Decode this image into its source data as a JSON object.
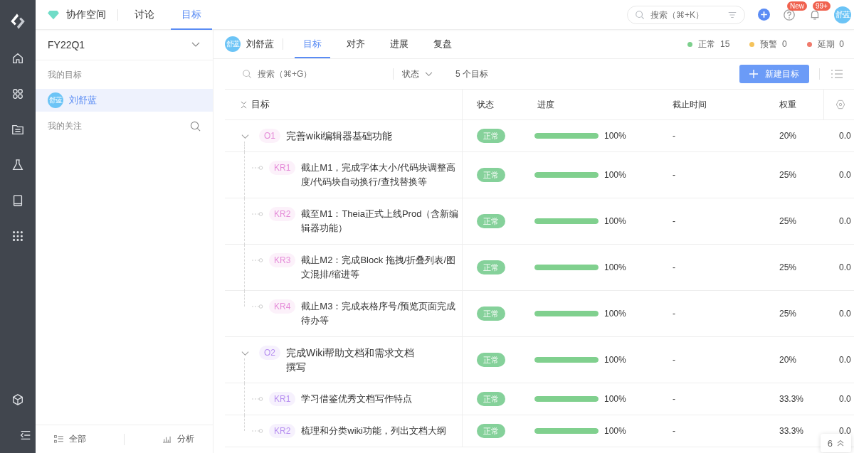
{
  "topbar": {
    "workspace": "协作空间",
    "tabs": [
      {
        "label": "讨论",
        "selected": false
      },
      {
        "label": "目标",
        "selected": true
      }
    ],
    "search": {
      "placeholder": "搜索（⌘+K）"
    },
    "help_badge": "New",
    "notification_badge": "99+",
    "avatar": "舒蓝"
  },
  "left_panel": {
    "period": "FY22Q1",
    "my_goals_label": "我的目标",
    "members": [
      {
        "avatar": "舒蓝",
        "name": "刘舒蓝",
        "selected": true
      }
    ],
    "following_label": "我的关注",
    "footer": [
      {
        "kind": "list",
        "label": "全部"
      },
      {
        "kind": "chart",
        "label": "分析"
      }
    ]
  },
  "main_header": {
    "avatar": "舒蓝",
    "name": "刘舒蓝",
    "tabs": [
      {
        "label": "目标",
        "selected": true
      },
      {
        "label": "对齐",
        "selected": false
      },
      {
        "label": "进展",
        "selected": false
      },
      {
        "label": "复盘",
        "selected": false
      }
    ],
    "status_counts": [
      {
        "label": "正常",
        "count": "15",
        "color": "#7ccf8c"
      },
      {
        "label": "预警",
        "count": "0",
        "color": "#f5c35b"
      },
      {
        "label": "延期",
        "count": "0",
        "color": "#f07a6c"
      }
    ]
  },
  "toolbar": {
    "search": {
      "placeholder": "搜索（⌘+G）"
    },
    "filter": "状态",
    "count": "5 个目标",
    "new_button": "新建目标"
  },
  "table": {
    "columns": [
      "目标",
      "状态",
      "进度",
      "截止时间",
      "权重"
    ],
    "objectives": [
      {
        "code": "O1",
        "title": "完善wiki编辑器基础功能",
        "color": "#e48bd8",
        "expanded": true,
        "status": "正常",
        "level": 1,
        "progress": "100%",
        "deadline": "-",
        "weight": "20%",
        "column_6": "0.0",
        "children": [
          {
            "code": "KR1",
            "title": "截止M1，完成字体大小/代码块调整高度/代码块自动换行/查找替换等",
            "status": "正常",
            "level": 1,
            "progress": "100%",
            "deadline": "-",
            "weight": "25%",
            "column_6": "0.0"
          },
          {
            "code": "KR2",
            "title": "截至M1：Theia正式上线Prod（含新编辑器功能）",
            "status": "正常",
            "level": 1,
            "progress": "100%",
            "deadline": "-",
            "weight": "25%",
            "column_6": "0.0"
          },
          {
            "code": "KR3",
            "title": "截止M2：完成Block 拖拽/折叠列表/图文混排/缩进等",
            "status": "正常",
            "level": 1,
            "progress": "100%",
            "deadline": "-",
            "weight": "25%",
            "column_6": "0.0"
          },
          {
            "code": "KR4",
            "title": "截止M3：完成表格序号/预览页面完成待办等",
            "status": "正常",
            "level": 1,
            "progress": "100%",
            "deadline": "-",
            "weight": "25%",
            "column_6": "0.0"
          }
        ]
      },
      {
        "code": "O2",
        "title": "完成Wiki帮助文档和需求文档撰写",
        "color": "#b68ef0",
        "expanded": true,
        "status": "正常",
        "level": 1,
        "progress": "100%",
        "deadline": "-",
        "weight": "20%",
        "column_6": "0.0",
        "children": [
          {
            "code": "KR1",
            "title": "学习借鉴优秀文档写作特点",
            "status": "正常",
            "level": 1,
            "progress": "100%",
            "deadline": "-",
            "weight": "33.3%",
            "column_6": "0.0"
          },
          {
            "code": "KR2",
            "title": "梳理和分类wiki功能，列出文档大纲",
            "status": "正常",
            "level": 1,
            "progress": "100%",
            "deadline": "-",
            "weight": "33.3%",
            "column_6": "0.0"
          }
        ]
      }
    ]
  },
  "scroll_top_button": {
    "count": "6"
  }
}
